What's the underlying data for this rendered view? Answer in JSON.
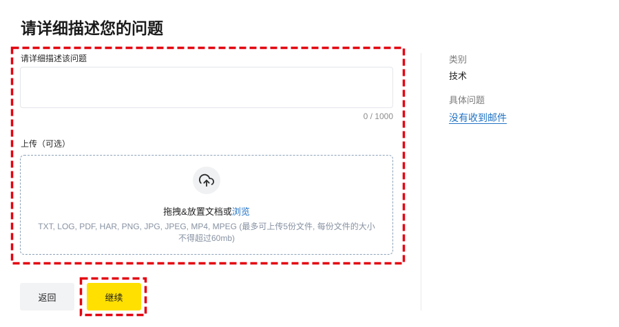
{
  "page": {
    "title": "请详细描述您的问题"
  },
  "form": {
    "description": {
      "label": "请详细描述该问题",
      "value": "",
      "counter": "0 / 1000"
    },
    "upload": {
      "label": "上传（可选）",
      "icon": "cloud-upload-icon",
      "drop_text": "拖拽&放置文档或",
      "browse_link": "浏览",
      "hint": "TXT, LOG, PDF, HAR, PNG, JPG, JPEG, MP4, MPEG (最多可上传5份文件, 每份文件的大小不得超过60mb)"
    }
  },
  "actions": {
    "back_label": "返回",
    "continue_label": "继续"
  },
  "summary": {
    "category_label": "类别",
    "category_value": "技术",
    "issue_label": "具体问题",
    "issue_value": "没有收到邮件"
  },
  "colors": {
    "primary_button": "#ffe000",
    "back_button": "#f2f3f5",
    "link": "#1f72c4",
    "highlight": "#e3000f"
  }
}
